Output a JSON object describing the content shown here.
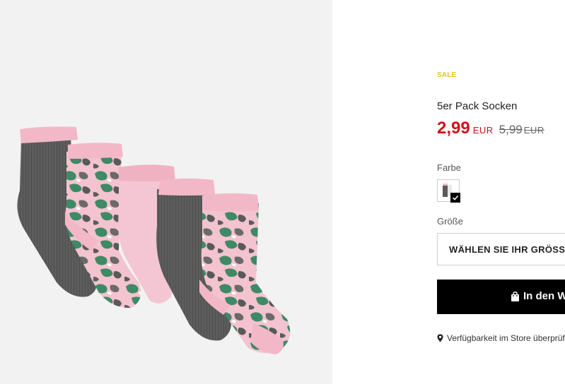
{
  "product": {
    "badge": "SALE",
    "title": "5er Pack Socken",
    "price": "2,99",
    "currency": "EUR",
    "old_price": "5,99",
    "old_currency": "EUR",
    "image_alt": "5 Paar Socken in Grau, Pink und Camouflage"
  },
  "color": {
    "label": "Farbe",
    "selected_swatch_icon": "checkmark-icon"
  },
  "size": {
    "label": "Größe",
    "select_text": "WÄHLEN SIE IHR GRÖSSE"
  },
  "cart": {
    "button_text": "In den Warenkorb",
    "icon": "shopping-bag-icon"
  },
  "store": {
    "text": "Verfügbarkeit im Store überprüfen",
    "icon": "location-pin-icon"
  },
  "colors": {
    "sale": "#e8c21c",
    "price": "#d0121b",
    "button_bg": "#000000",
    "sock_gray": "#5a5a5a",
    "sock_pink": "#f4c6d3",
    "camo_green": "#3f8a66"
  }
}
